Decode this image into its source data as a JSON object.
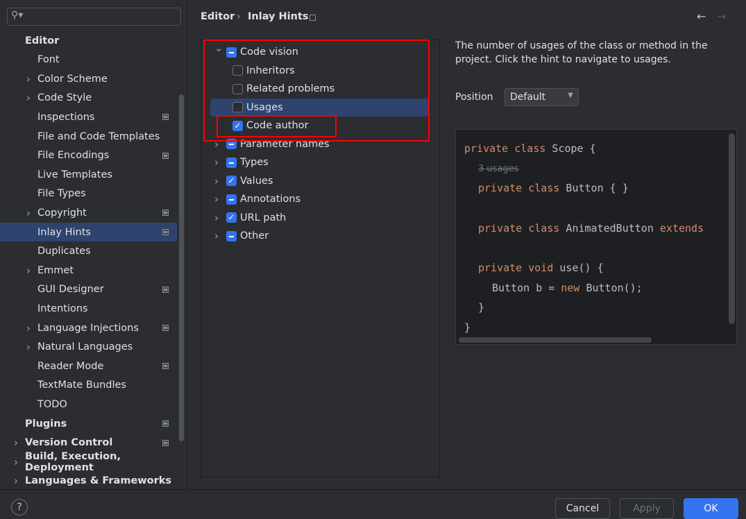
{
  "sidebar": {
    "search_placeholder": "",
    "items": [
      {
        "label": "Editor",
        "bold": true,
        "level": 0,
        "chev": false,
        "icon": false
      },
      {
        "label": "Font",
        "level": 1,
        "chev": false,
        "icon": false
      },
      {
        "label": "Color Scheme",
        "level": 1,
        "chev": true,
        "icon": false
      },
      {
        "label": "Code Style",
        "level": 1,
        "chev": true,
        "icon": false
      },
      {
        "label": "Inspections",
        "level": 1,
        "chev": false,
        "icon": true
      },
      {
        "label": "File and Code Templates",
        "level": 1,
        "chev": false,
        "icon": false
      },
      {
        "label": "File Encodings",
        "level": 1,
        "chev": false,
        "icon": true
      },
      {
        "label": "Live Templates",
        "level": 1,
        "chev": false,
        "icon": false
      },
      {
        "label": "File Types",
        "level": 1,
        "chev": false,
        "icon": false
      },
      {
        "label": "Copyright",
        "level": 1,
        "chev": true,
        "icon": true
      },
      {
        "label": "Inlay Hints",
        "level": 1,
        "chev": false,
        "icon": true,
        "selected": true
      },
      {
        "label": "Duplicates",
        "level": 1,
        "chev": false,
        "icon": false
      },
      {
        "label": "Emmet",
        "level": 1,
        "chev": true,
        "icon": false
      },
      {
        "label": "GUI Designer",
        "level": 1,
        "chev": false,
        "icon": true
      },
      {
        "label": "Intentions",
        "level": 1,
        "chev": false,
        "icon": false
      },
      {
        "label": "Language Injections",
        "level": 1,
        "chev": true,
        "icon": true
      },
      {
        "label": "Natural Languages",
        "level": 1,
        "chev": true,
        "icon": false
      },
      {
        "label": "Reader Mode",
        "level": 1,
        "chev": false,
        "icon": true
      },
      {
        "label": "TextMate Bundles",
        "level": 1,
        "chev": false,
        "icon": false
      },
      {
        "label": "TODO",
        "level": 1,
        "chev": false,
        "icon": false
      },
      {
        "label": "Plugins",
        "bold": true,
        "level": 0,
        "chev": false,
        "icon": true
      },
      {
        "label": "Version Control",
        "bold": true,
        "level": 0,
        "chev": true,
        "icon": true
      },
      {
        "label": "Build, Execution, Deployment",
        "bold": true,
        "level": 0,
        "chev": true,
        "icon": false
      },
      {
        "label": "Languages & Frameworks",
        "bold": true,
        "level": 0,
        "chev": true,
        "icon": false
      }
    ]
  },
  "breadcrumb": {
    "parent": "Editor",
    "current": "Inlay Hints"
  },
  "tree": [
    {
      "label": "Code vision",
      "state": "partial",
      "level": 0,
      "chev": "down"
    },
    {
      "label": "Inheritors",
      "state": "off",
      "level": 1
    },
    {
      "label": "Related problems",
      "state": "off",
      "level": 1
    },
    {
      "label": "Usages",
      "state": "off",
      "level": 1,
      "selected": true
    },
    {
      "label": "Code author",
      "state": "on",
      "level": 1
    },
    {
      "label": "Parameter names",
      "state": "partial",
      "level": 0,
      "chev": "right"
    },
    {
      "label": "Types",
      "state": "partial",
      "level": 0,
      "chev": "right"
    },
    {
      "label": "Values",
      "state": "on",
      "level": 0,
      "chev": "right"
    },
    {
      "label": "Annotations",
      "state": "partial",
      "level": 0,
      "chev": "right"
    },
    {
      "label": "URL path",
      "state": "on",
      "level": 0,
      "chev": "right"
    },
    {
      "label": "Other",
      "state": "partial",
      "level": 0,
      "chev": "right"
    }
  ],
  "detail": {
    "description": "The number of usages of the class or method in the project. Click the hint to navigate to usages.",
    "position_label": "Position",
    "position_value": "Default"
  },
  "code": {
    "hint": "3 usages"
  },
  "footer": {
    "help": "?",
    "cancel": "Cancel",
    "apply": "Apply",
    "ok": "OK"
  },
  "colors": {
    "accent": "#3574f0",
    "highlight": "#ff0000",
    "keyword": "#cf8e6d"
  }
}
